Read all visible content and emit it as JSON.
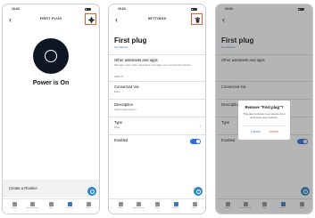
{
  "screens": [
    {
      "status_time": "10:24",
      "title": "FIRST PLUG",
      "power_label": "Power is On",
      "routine_label": "Create a Routine"
    },
    {
      "status_time": "10:24",
      "title": "SETTINGS",
      "plug_name": "First plug",
      "plug_sub": "Get Started",
      "rows": [
        {
          "label": "Other assistants and apps",
          "value": "Manage voice other assistants and apps can connect this device"
        },
        {
          "label": "Connected Via",
          "value": "Echo"
        },
        {
          "label": "Description",
          "value": "Add a plug system"
        },
        {
          "label": "Type",
          "value": "Plug"
        },
        {
          "label": "Enabled",
          "value": ""
        }
      ],
      "section_label": "ABOUT"
    },
    {
      "status_time": "10:24",
      "plug_name": "First plug",
      "plug_sub": "Get Started",
      "rows": [
        {
          "label": "Other assistants and apps",
          "value": ""
        },
        {
          "label": "Connected Via",
          "value": ""
        },
        {
          "label": "Description",
          "value": ""
        },
        {
          "label": "Type",
          "value": ""
        },
        {
          "label": "Enabled",
          "value": ""
        }
      ],
      "dialog": {
        "title": "Remove \"First plug\"?",
        "message": "This also removes your device from all groups and routines.",
        "cancel": "Cancel",
        "delete": "Delete"
      }
    }
  ],
  "navbar": {
    "items": [
      {
        "label": "Home",
        "icon": "home-icon"
      },
      {
        "label": "Communicate",
        "icon": "chat-icon"
      },
      {
        "label": "Play",
        "icon": "play-icon"
      },
      {
        "label": "Devices",
        "icon": "devices-icon"
      },
      {
        "label": "More",
        "icon": "more-icon"
      }
    ]
  },
  "colors": {
    "accent": "#3a78c4",
    "highlight": "#f25a2c",
    "toggle_on": "#2f6fd6",
    "fab": "#2a86c8"
  }
}
